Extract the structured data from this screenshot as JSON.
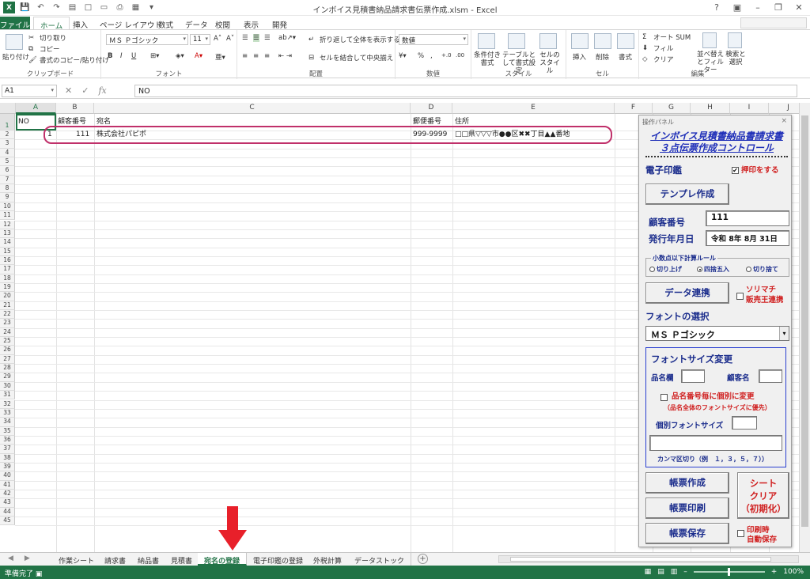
{
  "window": {
    "title": "インボイス見積書納品請求書伝票作成.xlsm - Excel"
  },
  "ribbon_tabs": [
    "ファイル",
    "ホーム",
    "挿入",
    "ページ レイアウト",
    "数式",
    "データ",
    "校閲",
    "表示",
    "開発"
  ],
  "ribbon": {
    "clipboard": {
      "paste": "貼り付け",
      "cut": "切り取り",
      "copy": "コピー",
      "format_painter": "書式のコピー/貼り付け",
      "label": "クリップボード"
    },
    "font": {
      "name": "ＭＳ Ｐゴシック",
      "size": "11",
      "bold": "B",
      "italic": "I",
      "underline": "U",
      "label": "フォント"
    },
    "alignment": {
      "wrap": "折り返して全体を表示する",
      "merge": "セルを結合して中央揃え",
      "label": "配置"
    },
    "number": {
      "format": "数値",
      "percent": "%",
      "comma": ",",
      "label": "数値"
    },
    "styles": {
      "conditional": "条件付き書式",
      "table": "テーブルとして書式設定",
      "cell_styles": "セルのスタイル",
      "label": "スタイル"
    },
    "cells": {
      "insert": "挿入",
      "delete": "削除",
      "format": "書式",
      "label": "セル"
    },
    "editing": {
      "autosum": "オート SUM",
      "fill": "フィル",
      "clear": "クリア",
      "sort": "並べ替えとフィルター",
      "find": "検索と選択",
      "label": "編集"
    }
  },
  "formula_bar": {
    "name_box": "A1",
    "content": "NO"
  },
  "columns": [
    "A",
    "B",
    "C",
    "D",
    "E",
    "F",
    "G",
    "H",
    "I",
    "J"
  ],
  "rows": [
    1,
    2,
    3,
    4,
    5,
    6,
    7,
    8,
    9,
    10,
    11,
    12,
    13,
    14,
    15,
    16,
    17,
    18,
    19,
    20,
    21,
    22,
    23,
    24,
    25,
    26,
    27,
    28,
    29,
    30,
    31,
    32,
    33,
    34,
    35,
    36,
    37,
    38,
    39,
    40,
    41,
    42,
    43,
    44,
    45
  ],
  "table": {
    "headers": {
      "A": "NO",
      "B": "顧客番号",
      "C": "宛名",
      "D": "郵便番号",
      "E": "住所"
    },
    "row2": {
      "A": "1",
      "B": "111",
      "C": "株式会社パピポ",
      "D": "999-9999",
      "E": "□□県▽▽▽市●●区✖✖丁目▲▲番地"
    }
  },
  "panel": {
    "title": "操作パネル",
    "close": "×",
    "heading_line1": "インボイス見積書納品書請求書",
    "heading_line2": "３点伝票作成コントロール",
    "seal_label": "電子印鑑",
    "seal_check_label": "押印をする",
    "seal_checked": true,
    "template_button": "テンプレ作成",
    "customer_no_label": "顧客番号",
    "customer_no_value": "111",
    "issue_date_label": "発行年月日",
    "issue_date_value": "令和 8年 8月 31日",
    "rounding_legend": "小数点以下計算ルール",
    "rounding_options": [
      "切り上げ",
      "四捨五入",
      "切り捨て"
    ],
    "rounding_selected": "四捨五入",
    "data_link_button": "データ連携",
    "sorimachi_label_1": "ソリマチ",
    "sorimachi_label_2": "販売王連携",
    "font_select_label": "フォントの選択",
    "font_select_value": "ＭＳ Ｐゴシック",
    "fontsize_heading": "フォントサイズ変更",
    "item_field_label": "品名欄",
    "customer_name_label": "顧客名",
    "individual_check_label": "品名番号毎に個別に変更",
    "individual_note": "（品名全体のフォントサイズに優先）",
    "individual_size_label": "個別フォントサイズ",
    "comma_note": "カンマ区切り（例　１，３，５，７））",
    "create_button": "帳票作成",
    "print_button": "帳票印刷",
    "save_button": "帳票保存",
    "clear_button_1": "シート",
    "clear_button_2": "クリア",
    "clear_button_3": "（初期化）",
    "autosave_label_1": "印刷時",
    "autosave_label_2": "自動保存"
  },
  "sheet_tabs": [
    "作業シート",
    "請求書",
    "納品書",
    "見積書",
    "宛名の登録",
    "電子印鑑の登録",
    "外税計算",
    "データストック"
  ],
  "active_sheet": "宛名の登録",
  "status": {
    "ready": "準備完了",
    "zoom": "100%"
  },
  "colors": {
    "excel_green": "#217346",
    "panel_navy": "#1a2c8c",
    "accent_red": "#d02020",
    "highlight_oval": "#c0306a"
  }
}
